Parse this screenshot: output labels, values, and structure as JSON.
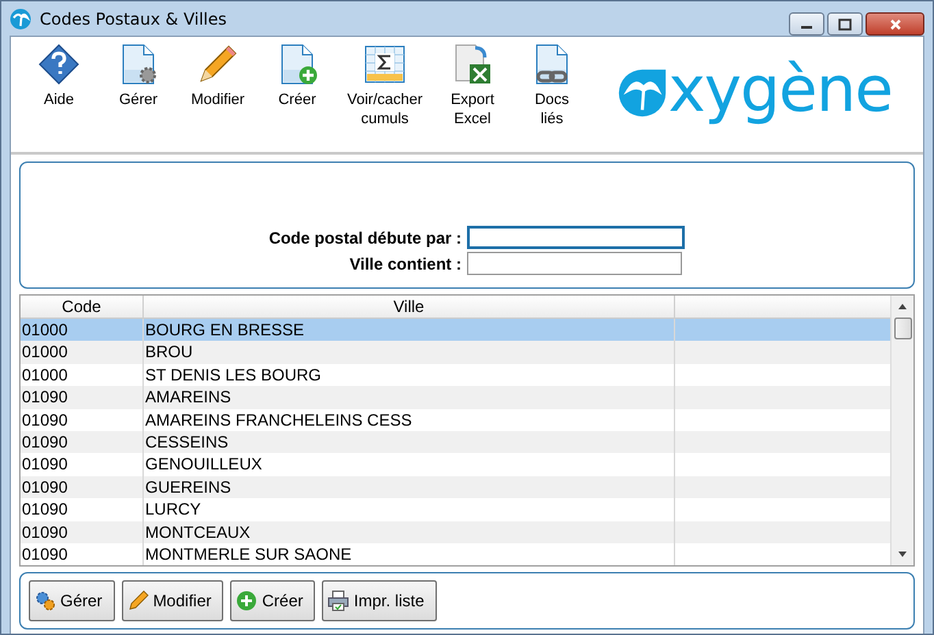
{
  "window": {
    "title": "Codes Postaux & Villes"
  },
  "toolbar": [
    {
      "kind": "help",
      "label": "Aide"
    },
    {
      "kind": "manage",
      "label": "Gérer"
    },
    {
      "kind": "edit",
      "label": "Modifier"
    },
    {
      "kind": "create",
      "label": "Créer"
    },
    {
      "kind": "totals",
      "label": "Voir/cacher cumuls"
    },
    {
      "kind": "excel",
      "label": "Export Excel"
    },
    {
      "kind": "docs",
      "label": "Docs liés"
    }
  ],
  "logo": {
    "text": "xygène"
  },
  "search": {
    "fields": [
      {
        "label": "Code postal débute par :",
        "focused": true
      },
      {
        "label": "Ville contient :",
        "focused": false
      }
    ]
  },
  "table": {
    "columns": [
      "Code",
      "Ville"
    ],
    "rows": [
      {
        "code": "01000",
        "ville": "BOURG EN BRESSE",
        "selected": true
      },
      {
        "code": "01000",
        "ville": "BROU",
        "selected": false
      },
      {
        "code": "01000",
        "ville": "ST DENIS LES BOURG",
        "selected": false
      },
      {
        "code": "01090",
        "ville": "AMAREINS",
        "selected": false
      },
      {
        "code": "01090",
        "ville": "AMAREINS FRANCHELEINS CESS",
        "selected": false
      },
      {
        "code": "01090",
        "ville": "CESSEINS",
        "selected": false
      },
      {
        "code": "01090",
        "ville": "GENOUILLEUX",
        "selected": false
      },
      {
        "code": "01090",
        "ville": "GUEREINS",
        "selected": false
      },
      {
        "code": "01090",
        "ville": "LURCY",
        "selected": false
      },
      {
        "code": "01090",
        "ville": "MONTCEAUX",
        "selected": false
      },
      {
        "code": "01090",
        "ville": "MONTMERLE SUR SAONE",
        "selected": false
      }
    ]
  },
  "buttons": [
    {
      "kind": "manage",
      "label": "Gérer"
    },
    {
      "kind": "edit",
      "label": "Modifier"
    },
    {
      "kind": "create",
      "label": "Créer"
    },
    {
      "kind": "print",
      "label": "Impr. liste"
    }
  ]
}
